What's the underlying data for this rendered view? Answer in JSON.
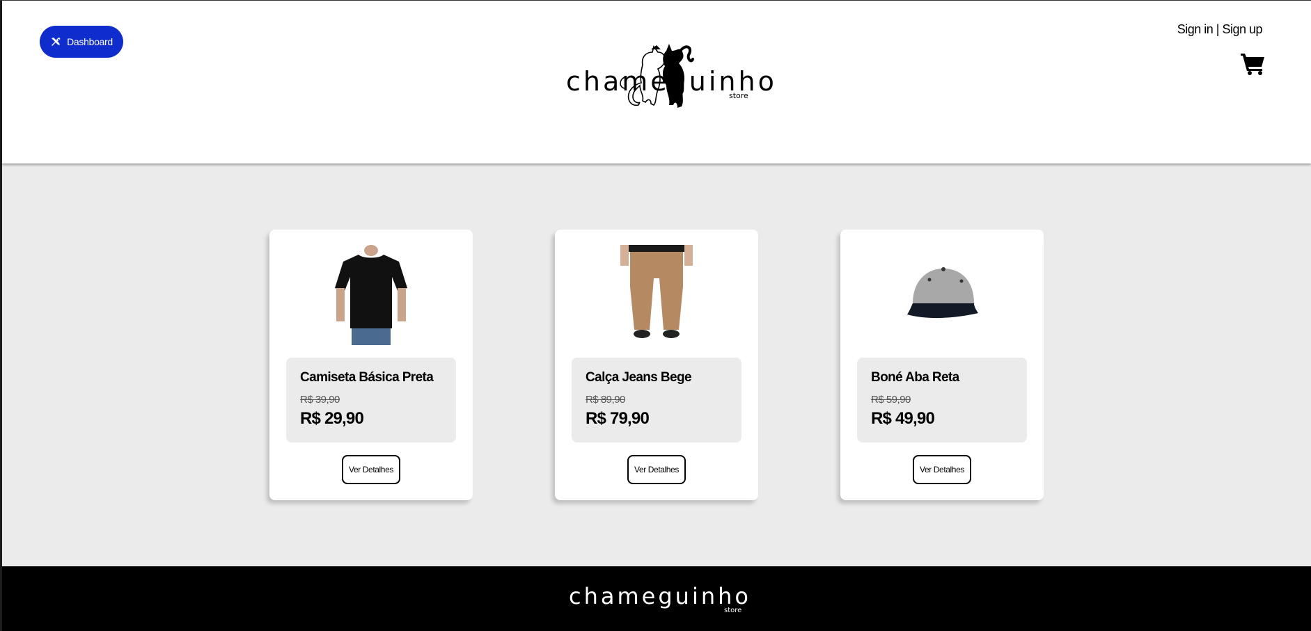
{
  "header": {
    "dashboard_label": "Dashboard",
    "logo_text": "chameguinho",
    "logo_sub": "store",
    "sign_in": "Sign in",
    "separator": " | ",
    "sign_up": "Sign up"
  },
  "products": [
    {
      "name": "Camiseta Básica Preta",
      "old_price": "R$ 39,90",
      "price": "R$ 29,90",
      "button": "Ver Detalhes",
      "image": "black-tshirt"
    },
    {
      "name": "Calça Jeans Bege",
      "old_price": "R$ 89,90",
      "price": "R$ 79,90",
      "button": "Ver Detalhes",
      "image": "beige-jeans"
    },
    {
      "name": "Boné Aba Reta",
      "old_price": "R$ 59,90",
      "price": "R$ 49,90",
      "button": "Ver Detalhes",
      "image": "grey-flat-cap"
    }
  ],
  "footer": {
    "logo_text": "chameguinho",
    "logo_sub": "store"
  },
  "colors": {
    "accent": "#0f2ccc",
    "page_bg": "#ebebeb",
    "footer_bg": "#000000"
  }
}
